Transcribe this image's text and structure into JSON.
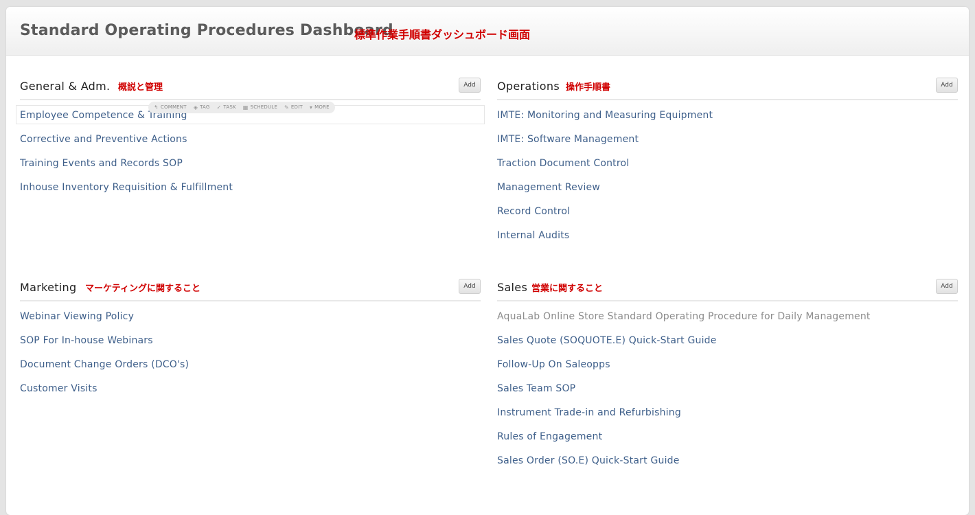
{
  "page": {
    "title": "Standard Operating Procedures Dashboard",
    "title_jp": "標準作業手順書ダッシュボード画面"
  },
  "hover_actions": {
    "comment": "COMMENT",
    "tag": "TAG",
    "task": "TASK",
    "schedule": "SCHEDULE",
    "edit": "EDIT",
    "more": "MORE"
  },
  "sections": {
    "general": {
      "title": "General & Adm.",
      "jp": "概説と管理",
      "add": "Add",
      "items": [
        "Employee Competence & Training",
        "Corrective and Preventive Actions",
        "Training Events and Records SOP",
        "Inhouse Inventory Requisition & Fulfillment"
      ]
    },
    "operations": {
      "title": "Operations",
      "jp": "操作手順書",
      "add": "Add",
      "items": [
        "IMTE: Monitoring and Measuring Equipment",
        "IMTE: Software Management",
        "Traction Document Control",
        "Management Review",
        "Record Control",
        "Internal Audits"
      ]
    },
    "marketing": {
      "title": "Marketing",
      "jp": "マーケティングに関すること",
      "add": "Add",
      "items": [
        "Webinar Viewing Policy",
        "SOP For In-house Webinars",
        "Document Change Orders (DCO's)",
        "Customer Visits"
      ]
    },
    "sales": {
      "title": "Sales",
      "jp": "営業に関すること",
      "add": "Add",
      "items": [
        "AquaLab Online Store Standard Operating Procedure for Daily Management",
        "Sales Quote (SOQUOTE.E) Quick-Start Guide",
        "Follow-Up On Saleopps",
        "Sales Team SOP",
        "Instrument Trade-in and Refurbishing",
        "Rules of Engagement",
        "Sales Order (SO.E) Quick-Start Guide"
      ]
    }
  },
  "colors": {
    "link": "#3e5f8a",
    "muted_link": "#8c8c8c",
    "annotation_red": "#d00000"
  }
}
